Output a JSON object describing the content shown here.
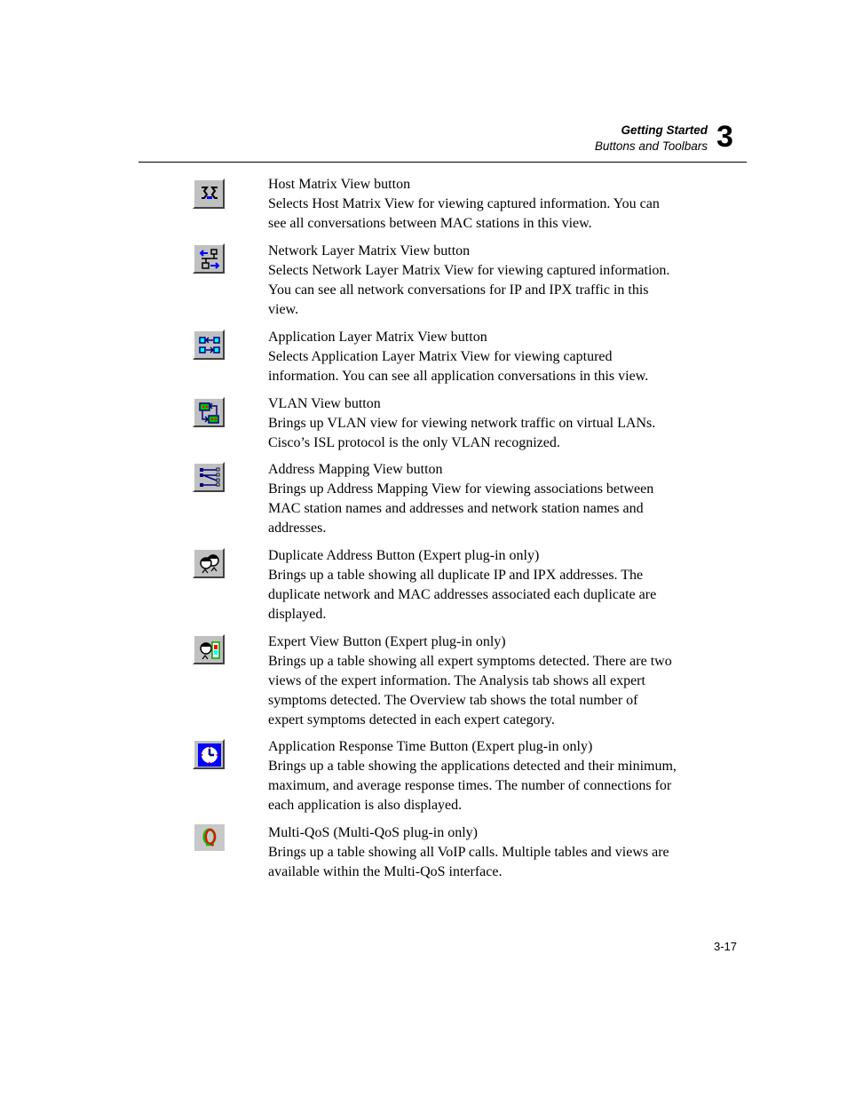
{
  "header": {
    "chapter_title": "Getting Started",
    "section_title": "Buttons and Toolbars",
    "chapter_number": "3"
  },
  "entries": [
    {
      "icon": "host-matrix-icon",
      "title": "Host Matrix View button",
      "lines": [
        "Selects Host Matrix View for viewing captured information. You can",
        "see all conversations between MAC stations in this view."
      ]
    },
    {
      "icon": "network-layer-matrix-icon",
      "title": "Network Layer Matrix View button",
      "lines": [
        "Selects Network Layer Matrix View for viewing captured information.",
        "You can see all network conversations for IP and IPX traffic in this",
        "view."
      ]
    },
    {
      "icon": "application-layer-matrix-icon",
      "title": "Application Layer Matrix View button",
      "lines": [
        "Selects Application Layer Matrix View for viewing captured",
        "information. You can see all application conversations in this view."
      ]
    },
    {
      "icon": "vlan-icon",
      "title": "VLAN View button",
      "lines": [
        "Brings up VLAN view for viewing network traffic on virtual LANs.",
        "Cisco’s ISL protocol is the only VLAN recognized."
      ]
    },
    {
      "icon": "address-mapping-icon",
      "title": "Address Mapping View button",
      "lines": [
        "Brings up Address Mapping View for viewing associations between",
        "MAC station names and addresses and network station names and",
        "addresses."
      ]
    },
    {
      "icon": "duplicate-address-icon",
      "title": "Duplicate Address Button (Expert plug-in only)",
      "lines": [
        "Brings up a table showing all duplicate IP and IPX addresses. The",
        "duplicate network and MAC addresses associated each duplicate are",
        "displayed."
      ]
    },
    {
      "icon": "expert-view-icon",
      "title": "Expert View Button (Expert plug-in only)",
      "lines": [
        "Brings up a table showing all expert symptoms detected. There are two",
        "views of the expert information. The Analysis tab shows all expert",
        "symptoms detected. The Overview tab shows the total number of",
        "expert symptoms detected in each expert category."
      ]
    },
    {
      "icon": "clock-icon",
      "title": "Application Response Time Button (Expert plug-in only)",
      "lines": [
        "Brings up a table showing the applications detected and their minimum,",
        "maximum, and average response times. The number of connections for",
        "each application is also displayed."
      ]
    },
    {
      "icon": "multi-qos-icon",
      "title": "Multi-QoS (Multi-QoS plug-in only)",
      "lines": [
        "Brings up a table showing all VoIP calls. Multiple tables and views are",
        "available within the Multi-QoS interface."
      ]
    }
  ],
  "footer": {
    "page_number": "3-17"
  }
}
